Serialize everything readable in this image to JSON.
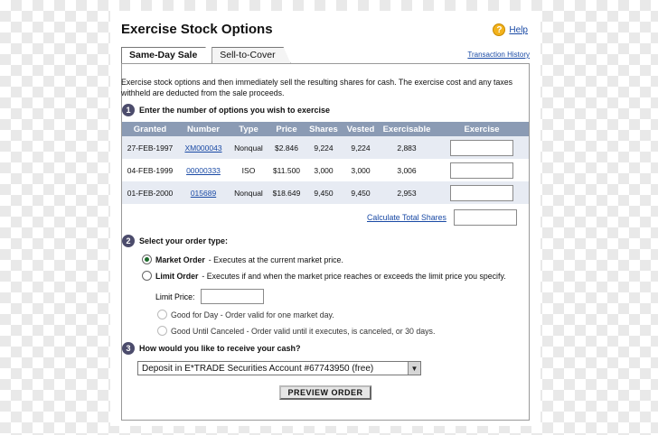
{
  "title": "Exercise Stock Options",
  "help": {
    "icon": "help-icon",
    "label": "Help"
  },
  "tabs": [
    {
      "label": "Same-Day Sale",
      "active": true
    },
    {
      "label": "Sell-to-Cover",
      "active": false
    }
  ],
  "transaction_history": "Transaction History",
  "intro": "Exercise stock options and then immediately sell the resulting shares for cash. The exercise cost and any taxes withheld are deducted from the sale proceeds.",
  "step1": {
    "num": "1",
    "label": "Enter the number of options you wish to exercise"
  },
  "table": {
    "headers": [
      "Granted",
      "Number",
      "Type",
      "Price",
      "Shares",
      "Vested",
      "Exercisable",
      "Exercise"
    ],
    "rows": [
      {
        "granted": "27-FEB-1997",
        "number": "XM000043",
        "type": "Nonqual",
        "price": "$2.846",
        "shares": "9,224",
        "vested": "9,224",
        "exercisable": "2,883",
        "exercise": ""
      },
      {
        "granted": "04-FEB-1999",
        "number": "00000333",
        "type": "ISO",
        "price": "$11.500",
        "shares": "3,000",
        "vested": "3,000",
        "exercisable": "3,006",
        "exercise": ""
      },
      {
        "granted": "01-FEB-2000",
        "number": "015689",
        "type": "Nonqual",
        "price": "$18.649",
        "shares": "9,450",
        "vested": "9,450",
        "exercisable": "2,953",
        "exercise": ""
      }
    ]
  },
  "calc_total": "Calculate Total Shares",
  "step2": {
    "num": "2",
    "label": "Select your order type:"
  },
  "order_types": {
    "market": {
      "name": "Market Order",
      "desc": " - Executes at the current market price.",
      "selected": true
    },
    "limit": {
      "name": "Limit Order",
      "desc": " - Executes if and when the market price reaches or exceeds the limit price you specify.",
      "selected": false
    }
  },
  "limit_price_label": "Limit Price:",
  "duration": {
    "day": "Good for Day - Order valid for one market day.",
    "gtc": "Good Until Canceled - Order valid until it executes, is canceled, or 30 days."
  },
  "step3": {
    "num": "3",
    "label": "How would you like to receive your cash?"
  },
  "receive_select": "Deposit in E*TRADE Securities Account #67743950 (free)",
  "preview_button": "PREVIEW ORDER",
  "colors": {
    "header_bg": "#8b9bb4",
    "row_alt": "#e7ebf3",
    "link": "#1a4aa5",
    "help": "#f2b21c",
    "step": "#4c4c6c"
  }
}
